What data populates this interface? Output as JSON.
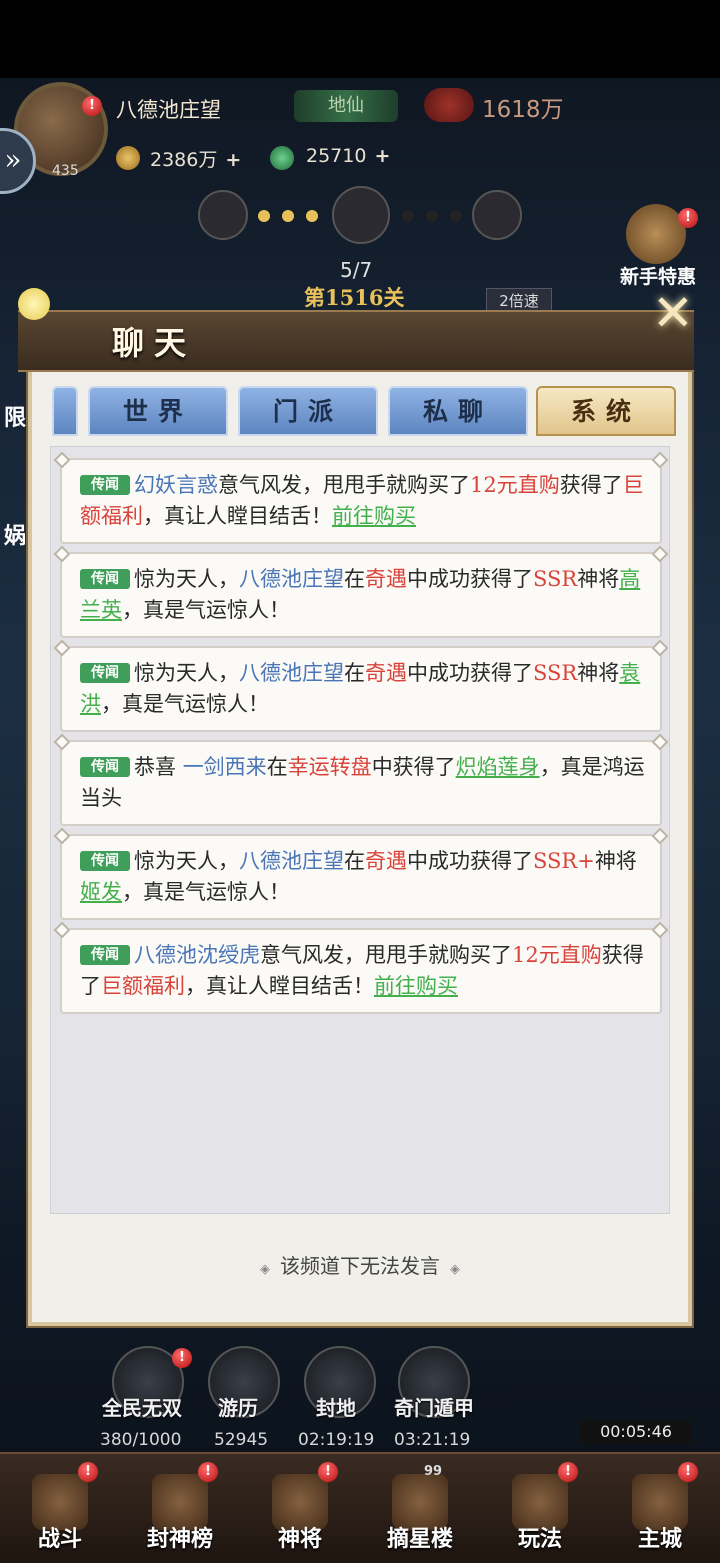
{
  "player": {
    "name": "八德池庄望",
    "level": "435",
    "rank": "地仙",
    "power": "1618万",
    "alert": "!"
  },
  "resources": {
    "coins": "2386万",
    "jade": "25710",
    "plus": "+"
  },
  "stage": {
    "progress": "5/7",
    "name": "第1516关",
    "speed": "2倍速"
  },
  "side": {
    "newbie": "新手特惠",
    "limit": "限",
    "other": "娲"
  },
  "chat": {
    "title": "聊天",
    "close": "✕",
    "tabs": [
      {
        "label": "世界",
        "active": false
      },
      {
        "label": "门派",
        "active": false
      },
      {
        "label": "私聊",
        "active": false
      },
      {
        "label": "系统",
        "active": true
      }
    ],
    "tag": "传闻",
    "messages": [
      {
        "parts": [
          [
            "blue",
            "幻妖言惑"
          ],
          [
            "plain",
            "意气风发，甩甩手就购买了"
          ],
          [
            "red",
            "12元直购"
          ],
          [
            "plain",
            "获得了"
          ],
          [
            "red",
            "巨额福利"
          ],
          [
            "plain",
            "，真让人瞠目结舌！"
          ],
          [
            "link",
            "前往购买"
          ]
        ]
      },
      {
        "parts": [
          [
            "plain",
            "惊为天人，"
          ],
          [
            "blue",
            "八德池庄望"
          ],
          [
            "plain",
            "在"
          ],
          [
            "red",
            "奇遇"
          ],
          [
            "plain",
            "中成功获得了"
          ],
          [
            "red",
            "SSR"
          ],
          [
            "plain",
            "神将"
          ],
          [
            "link",
            "高兰英"
          ],
          [
            "plain",
            "，真是气运惊人！"
          ]
        ]
      },
      {
        "parts": [
          [
            "plain",
            "惊为天人，"
          ],
          [
            "blue",
            "八德池庄望"
          ],
          [
            "plain",
            "在"
          ],
          [
            "red",
            "奇遇"
          ],
          [
            "plain",
            "中成功获得了"
          ],
          [
            "red",
            "SSR"
          ],
          [
            "plain",
            "神将"
          ],
          [
            "link",
            "袁洪"
          ],
          [
            "plain",
            "，真是气运惊人！"
          ]
        ]
      },
      {
        "parts": [
          [
            "plain",
            "恭喜 "
          ],
          [
            "blue",
            "一剑西来"
          ],
          [
            "plain",
            "在"
          ],
          [
            "red",
            "幸运转盘"
          ],
          [
            "plain",
            "中获得了"
          ],
          [
            "link",
            "炽焰莲身"
          ],
          [
            "plain",
            "，真是鸿运当头"
          ]
        ]
      },
      {
        "parts": [
          [
            "plain",
            "惊为天人，"
          ],
          [
            "blue",
            "八德池庄望"
          ],
          [
            "plain",
            "在"
          ],
          [
            "red",
            "奇遇"
          ],
          [
            "plain",
            "中成功获得了"
          ],
          [
            "red",
            "SSR+"
          ],
          [
            "plain",
            "神将"
          ],
          [
            "link",
            "姬发"
          ],
          [
            "plain",
            "，真是气运惊人！"
          ]
        ]
      },
      {
        "parts": [
          [
            "blue",
            "八德池沈绶虎"
          ],
          [
            "plain",
            "意气风发，甩甩手就购买了"
          ],
          [
            "red",
            "12元直购"
          ],
          [
            "plain",
            "获得了"
          ],
          [
            "red",
            "巨额福利"
          ],
          [
            "plain",
            "，真让人瞠目结舌！"
          ],
          [
            "link",
            "前往购买"
          ]
        ]
      }
    ],
    "footer": "该频道下无法发言",
    "footer_ornament_left": "◈",
    "footer_ornament_right": "◈"
  },
  "functions": [
    {
      "label": "全民无双",
      "value": "380/1000"
    },
    {
      "label": "游历",
      "value": "52945"
    },
    {
      "label": "封地",
      "value": "02:19:19"
    },
    {
      "label": "奇门遁甲",
      "value": "03:21:19"
    }
  ],
  "timer": "00:05:46",
  "nav": [
    {
      "label": "战斗",
      "badge": "!"
    },
    {
      "label": "封神榜",
      "badge": "!"
    },
    {
      "label": "神将",
      "badge": "!"
    },
    {
      "label": "摘星楼",
      "badge": "99"
    },
    {
      "label": "玩法",
      "badge": "!"
    },
    {
      "label": "主城",
      "badge": "!"
    }
  ],
  "colors": {
    "tag_green": "#3e9e5a",
    "name_blue": "#4a76b6",
    "highlight_red": "#d9433a",
    "link_green": "#43b04c",
    "active_tab": "#e1c58c",
    "inactive_tab": "#5e85c0"
  }
}
